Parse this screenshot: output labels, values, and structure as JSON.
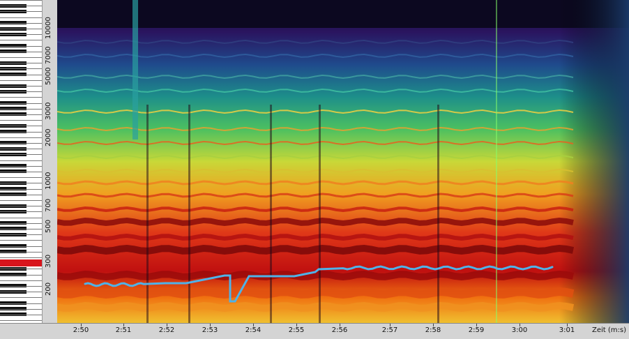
{
  "frequency_axis": {
    "labels": [
      "10000",
      "7000",
      "5000",
      "3000",
      "2000",
      "1000",
      "700",
      "500",
      "300",
      "200"
    ],
    "values": [
      10000,
      7000,
      5000,
      3000,
      2000,
      1000,
      700,
      500,
      300,
      200
    ]
  },
  "time_axis": {
    "labels": [
      "2:50",
      "2:51",
      "2:52",
      "2:53",
      "2:54",
      "2:55",
      "2:56",
      "2:57",
      "2:58",
      "2:59",
      "3:00",
      "3:01"
    ],
    "unit_label": "Zeit (m:s)"
  },
  "colors": {
    "pitch_line": "#4fb2e8",
    "cursor_line": "#86ff6a",
    "piano_marker": "#d8141c"
  },
  "playback_cursor_time": "2:59.4"
}
